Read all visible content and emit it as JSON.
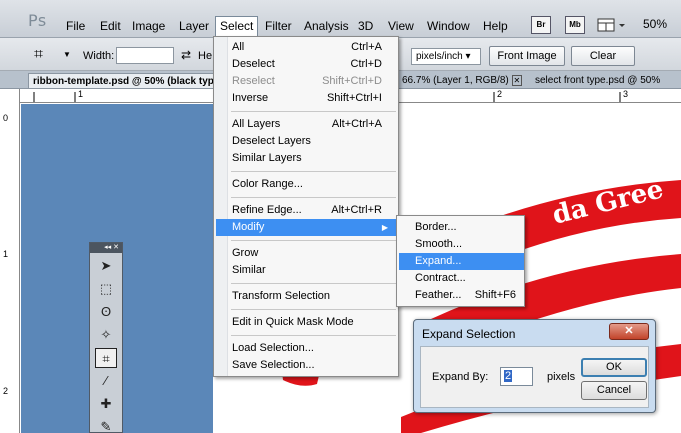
{
  "app": {
    "logo": "Ps"
  },
  "menubar": {
    "items": [
      "File",
      "Edit",
      "Image",
      "Layer",
      "Select",
      "Filter",
      "Analysis",
      "3D",
      "View",
      "Window",
      "Help"
    ],
    "active": "Select",
    "mini_buttons": [
      "Br",
      "Mb"
    ],
    "zoom": "50%"
  },
  "options": {
    "width_label": "Width:",
    "height_label": "He",
    "units": "pixels/inch",
    "front_image": "Front Image",
    "clear": "Clear"
  },
  "tabs": [
    {
      "label": "ribbon-template.psd @ 50% (black typ",
      "current": true
    },
    {
      "label": "66.7% (Layer 1, RGB/8)"
    },
    {
      "label": "select front type.psd @ 50%"
    }
  ],
  "rulers": {
    "top": [
      "1",
      "2",
      "3"
    ],
    "left": [
      "0",
      "1",
      "2"
    ]
  },
  "select_menu": {
    "items": [
      {
        "label": "All",
        "shortcut": "Ctrl+A"
      },
      {
        "label": "Deselect",
        "shortcut": "Ctrl+D"
      },
      {
        "label": "Reselect",
        "shortcut": "Shift+Ctrl+D",
        "disabled": true
      },
      {
        "label": "Inverse",
        "shortcut": "Shift+Ctrl+I"
      },
      {
        "label": "All Layers",
        "shortcut": "Alt+Ctrl+A"
      },
      {
        "label": "Deselect Layers",
        "shortcut": ""
      },
      {
        "label": "Similar Layers",
        "shortcut": ""
      },
      {
        "label": "Color Range...",
        "shortcut": ""
      },
      {
        "label": "Refine Edge...",
        "shortcut": "Alt+Ctrl+R"
      },
      {
        "label": "Modify",
        "shortcut": ""
      },
      {
        "label": "Grow",
        "shortcut": ""
      },
      {
        "label": "Similar",
        "shortcut": ""
      },
      {
        "label": "Transform Selection",
        "shortcut": ""
      },
      {
        "label": "Edit in Quick Mask Mode",
        "shortcut": ""
      },
      {
        "label": "Load Selection...",
        "shortcut": ""
      },
      {
        "label": "Save Selection...",
        "shortcut": ""
      }
    ]
  },
  "modify_menu": {
    "items": [
      {
        "label": "Border...",
        "shortcut": ""
      },
      {
        "label": "Smooth...",
        "shortcut": ""
      },
      {
        "label": "Expand...",
        "shortcut": ""
      },
      {
        "label": "Contract...",
        "shortcut": ""
      },
      {
        "label": "Feather...",
        "shortcut": "Shift+F6"
      }
    ]
  },
  "dialog": {
    "title": "Expand Selection",
    "expand_label": "Expand By:",
    "expand_value": "2",
    "unit": "pixels",
    "ok": "OK",
    "cancel": "Cancel"
  },
  "canvas": {
    "ribbon_text": "da Gree"
  },
  "colors": {
    "blue_bg": "#5b87b8",
    "ribbon_red": "#e0141a",
    "menu_highlight": "#3d8ff2"
  }
}
